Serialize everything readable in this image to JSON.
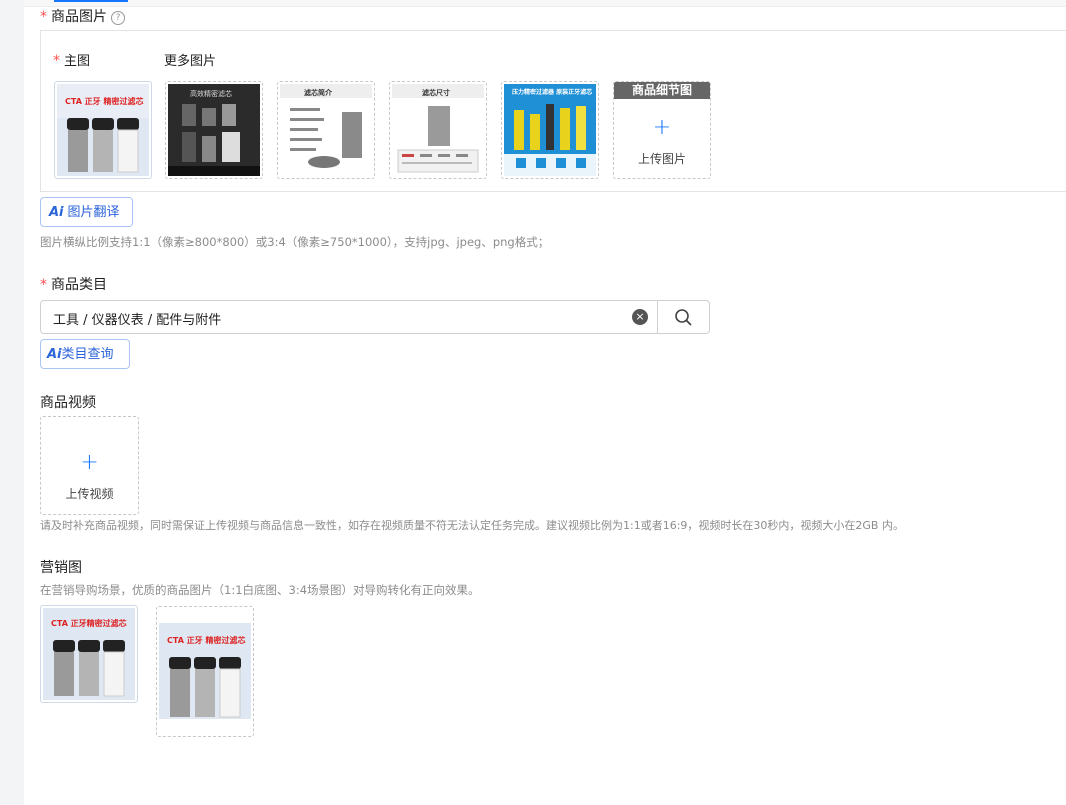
{
  "product_images": {
    "label": "商品图片",
    "required_mark": "*",
    "main_label": "主图",
    "more_label": "更多图片",
    "thumbnails": [
      {
        "name": "main-image",
        "caption": "CTA 正牙 精密过滤芯"
      },
      {
        "name": "more-image-1",
        "caption": "高效精密滤芯"
      },
      {
        "name": "more-image-2",
        "caption": "滤芯简介"
      },
      {
        "name": "more-image-3",
        "caption": "滤芯尺寸"
      },
      {
        "name": "more-image-4",
        "caption": "压力精密过滤器 原装正牙滤芯"
      }
    ],
    "detail_header": "商品细节图",
    "upload_plus": "+",
    "upload_label": "上传图片",
    "ai_prefix": "Ai",
    "ai_translate_label": "图片翻译",
    "hint": "图片横纵比例支持1:1（像素≥800*800）或3:4（像素≥750*1000），支持jpg、jpeg、png格式；"
  },
  "category": {
    "label": "商品类目",
    "required_mark": "*",
    "value": "工具 / 仪器仪表 / 配件与附件",
    "clear_icon": "×",
    "ai_prefix": "Ai",
    "ai_query_label": "类目查询"
  },
  "video": {
    "label": "商品视频",
    "upload_plus": "+",
    "upload_label": "上传视频",
    "hint": "请及时补充商品视频，同时需保证上传视频与商品信息一致性，如存在视频质量不符无法认定任务完成。建议视频比例为1:1或者16:9，视频时长在30秒内，视频大小在2GB 内。"
  },
  "marketing": {
    "label": "营销图",
    "hint": "在营销导购场景，优质的商品图片（1:1白底图、3:4场景图）对导购转化有正向效果。",
    "images": [
      {
        "name": "marketing-image-square",
        "caption": "CTA 正牙精密过滤芯"
      },
      {
        "name": "marketing-image-portrait",
        "caption": "CTA 正牙 精密过滤芯"
      }
    ]
  },
  "colors": {
    "accent": "#1677ff",
    "required": "#ff4d4f",
    "hint": "#8c8c8c"
  }
}
